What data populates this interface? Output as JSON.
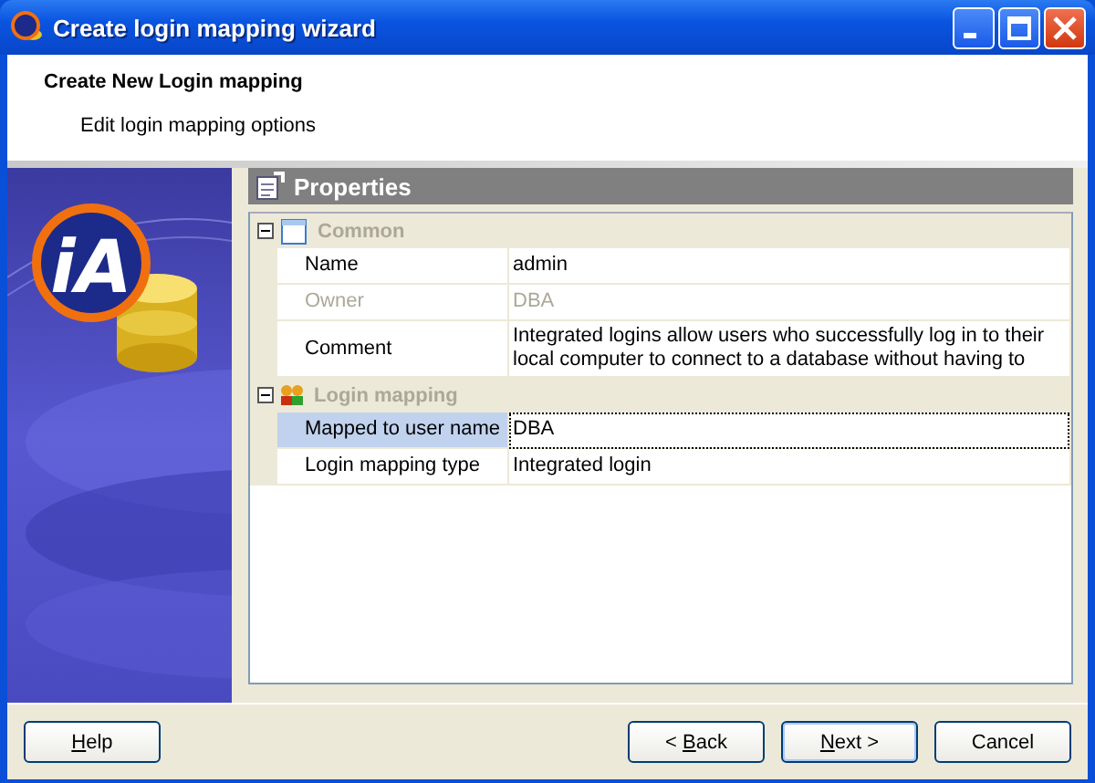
{
  "window": {
    "title": "Create login mapping wizard"
  },
  "header": {
    "title": "Create New Login mapping",
    "subtitle": "Edit login mapping options"
  },
  "banner": {
    "logo_text": "iA"
  },
  "properties": {
    "title": "Properties",
    "groups": [
      {
        "label": "Common",
        "kind": "window",
        "expanded": true,
        "rows": [
          {
            "label": "Name",
            "value": "admin",
            "disabled": false,
            "selected": false
          },
          {
            "label": "Owner",
            "value": "DBA",
            "disabled": true,
            "selected": false
          },
          {
            "label": "Comment",
            "value": "Integrated logins allow users who successfully log in to their local computer to connect to a database without having to",
            "disabled": false,
            "selected": false
          }
        ]
      },
      {
        "label": "Login mapping",
        "kind": "people",
        "expanded": true,
        "rows": [
          {
            "label": "Mapped to user name",
            "value": "DBA",
            "disabled": false,
            "selected": true
          },
          {
            "label": "Login mapping type",
            "value": "Integrated login",
            "disabled": false,
            "selected": false
          }
        ]
      }
    ]
  },
  "buttons": [
    {
      "kind": "help",
      "default": false,
      "parts": [
        {
          "text": "H",
          "underlined": true
        },
        {
          "text": "elp",
          "underlined": false
        }
      ]
    },
    {
      "kind": "nav",
      "default": false,
      "parts": [
        {
          "text": "< ",
          "underlined": false
        },
        {
          "text": "B",
          "underlined": true
        },
        {
          "text": "ack",
          "underlined": false
        }
      ]
    },
    {
      "kind": "nav",
      "default": true,
      "parts": [
        {
          "text": "N",
          "underlined": true
        },
        {
          "text": "ext >",
          "underlined": false
        }
      ]
    },
    {
      "kind": "nav",
      "default": false,
      "parts": [
        {
          "text": "Cancel",
          "underlined": false
        }
      ]
    }
  ]
}
